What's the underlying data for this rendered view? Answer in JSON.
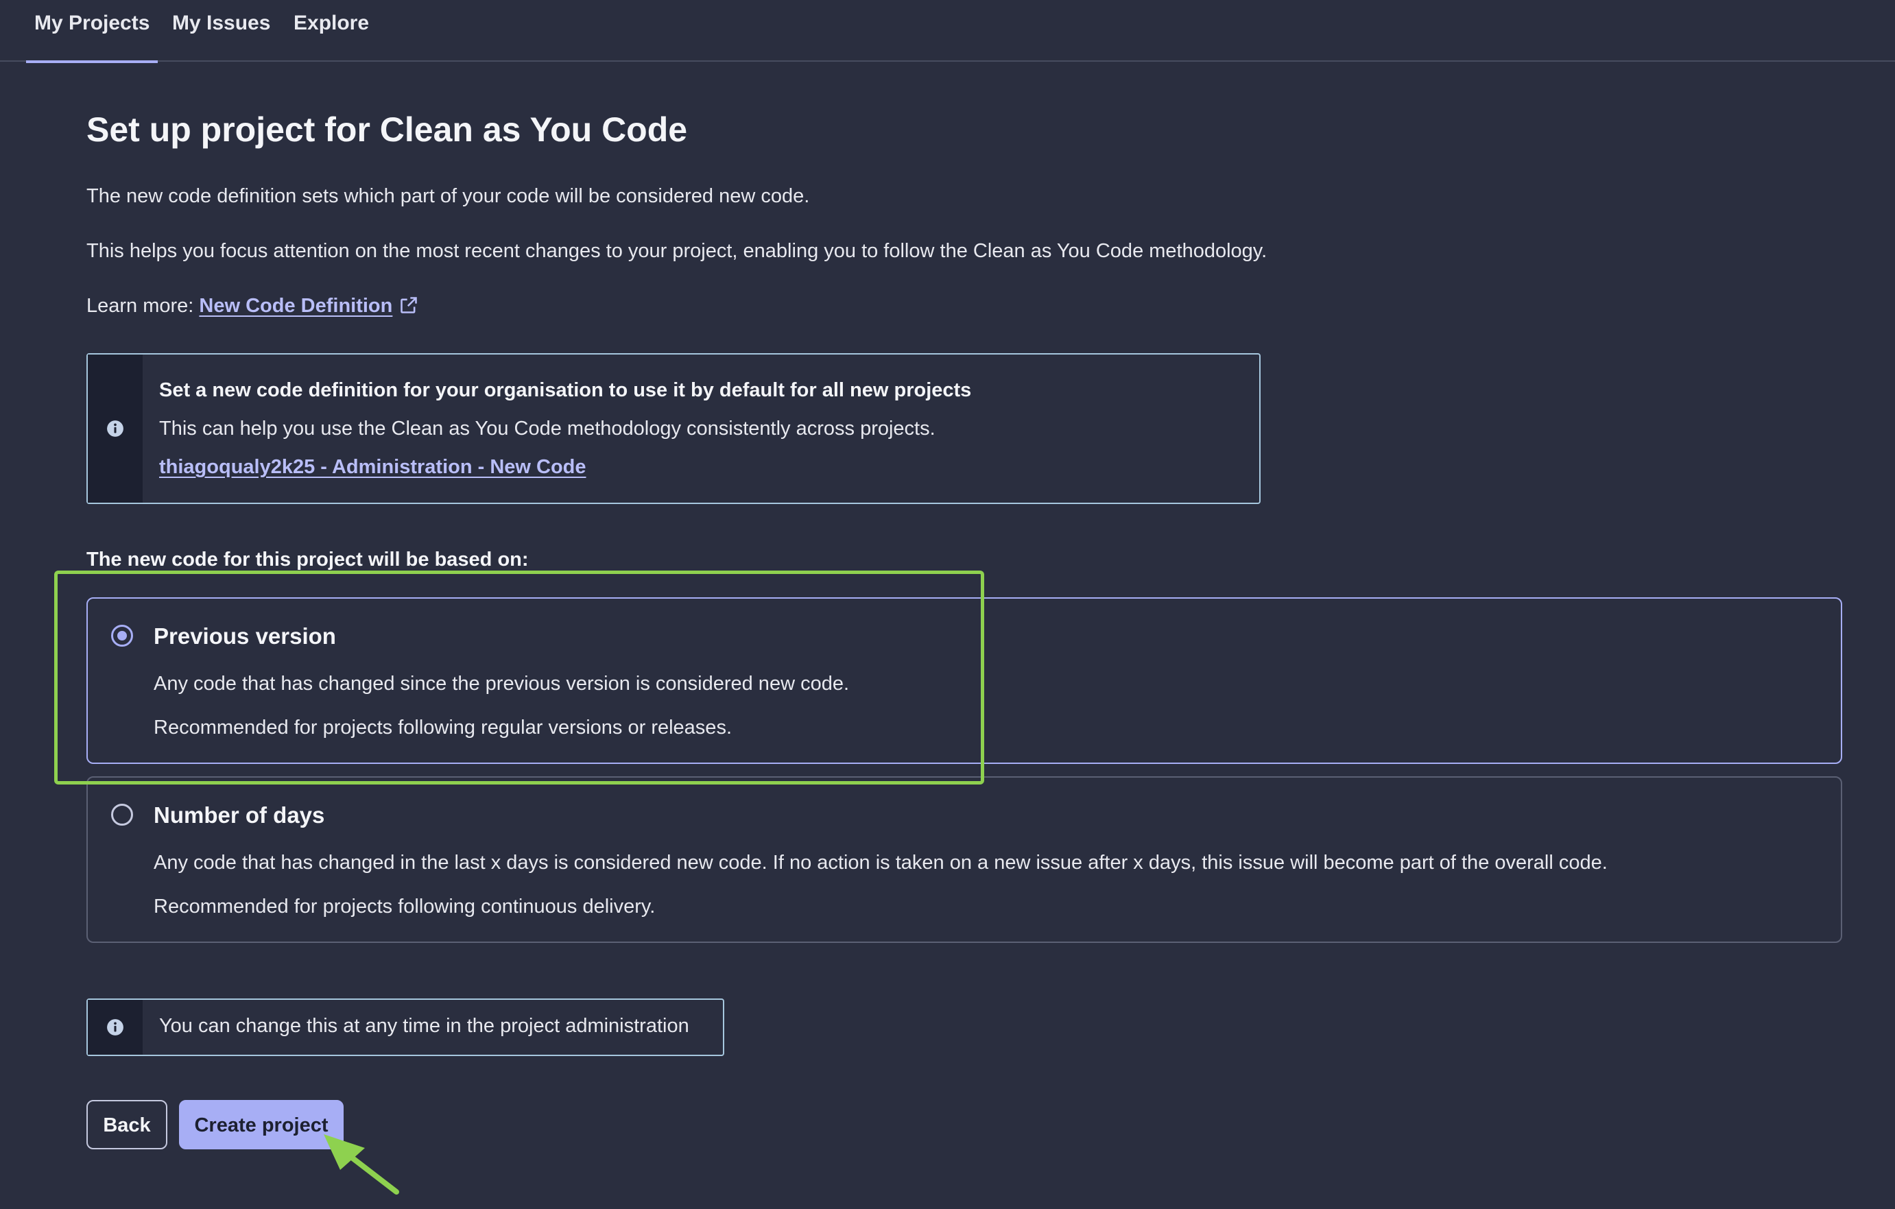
{
  "nav": {
    "tabs": [
      {
        "label": "My Projects",
        "active": true
      },
      {
        "label": "My Issues",
        "active": false
      },
      {
        "label": "Explore",
        "active": false
      }
    ]
  },
  "page": {
    "title": "Set up project for Clean as You Code",
    "para1": "The new code definition sets which part of your code will be considered new code.",
    "para2": "This helps you focus attention on the most recent changes to your project, enabling you to follow the Clean as You Code methodology.",
    "learn_more_prefix": "Learn more:",
    "learn_more_link": "New Code Definition"
  },
  "org_banner": {
    "title": "Set a new code definition for your organisation to use it by default for all new projects",
    "text": "This can help you use the Clean as You Code methodology consistently across projects.",
    "link": "thiagoqualy2k25 - Administration - New Code"
  },
  "section_label": "The new code for this project will be based on:",
  "options": [
    {
      "title": "Previous version",
      "line1": "Any code that has changed since the previous version is considered new code.",
      "line2": "Recommended for projects following regular versions or releases.",
      "selected": true
    },
    {
      "title": "Number of days",
      "line1": "Any code that has changed in the last x days is considered new code. If no action is taken on a new issue after x days, this issue will become part of the overall code.",
      "line2": "Recommended for projects following continuous delivery.",
      "selected": false
    }
  ],
  "change_banner": {
    "text": "You can change this at any time in the project administration"
  },
  "buttons": {
    "back": "Back",
    "create": "Create project"
  },
  "colors": {
    "background": "#2a2e3f",
    "accent": "#a7aef5",
    "link": "#b9bef8",
    "annotation": "#8ed14f"
  },
  "icons": {
    "info": "info-circle-icon",
    "external_link": "external-link-icon",
    "radio_selected": "radio-checked-icon",
    "radio_unselected": "radio-unchecked-icon"
  }
}
